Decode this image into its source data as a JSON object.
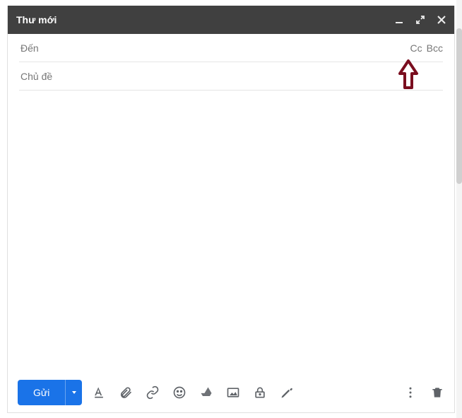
{
  "header": {
    "title": "Thư mới"
  },
  "fields": {
    "to_placeholder": "Đến",
    "cc_label": "Cc",
    "bcc_label": "Bcc",
    "subject_placeholder": "Chủ đề"
  },
  "footer": {
    "send_label": "Gửi"
  },
  "icons": {
    "minimize": "minimize",
    "fullscreen": "fullscreen",
    "close": "close",
    "format": "format-text",
    "attach": "attach",
    "link": "link",
    "emoji": "emoji",
    "drive": "drive",
    "image": "image",
    "confidential": "confidential",
    "pen": "pen",
    "more": "more-vertical",
    "trash": "trash"
  },
  "annotation": {
    "type": "up-arrow",
    "color": "#7a0e1f",
    "points_to": "Bcc"
  }
}
